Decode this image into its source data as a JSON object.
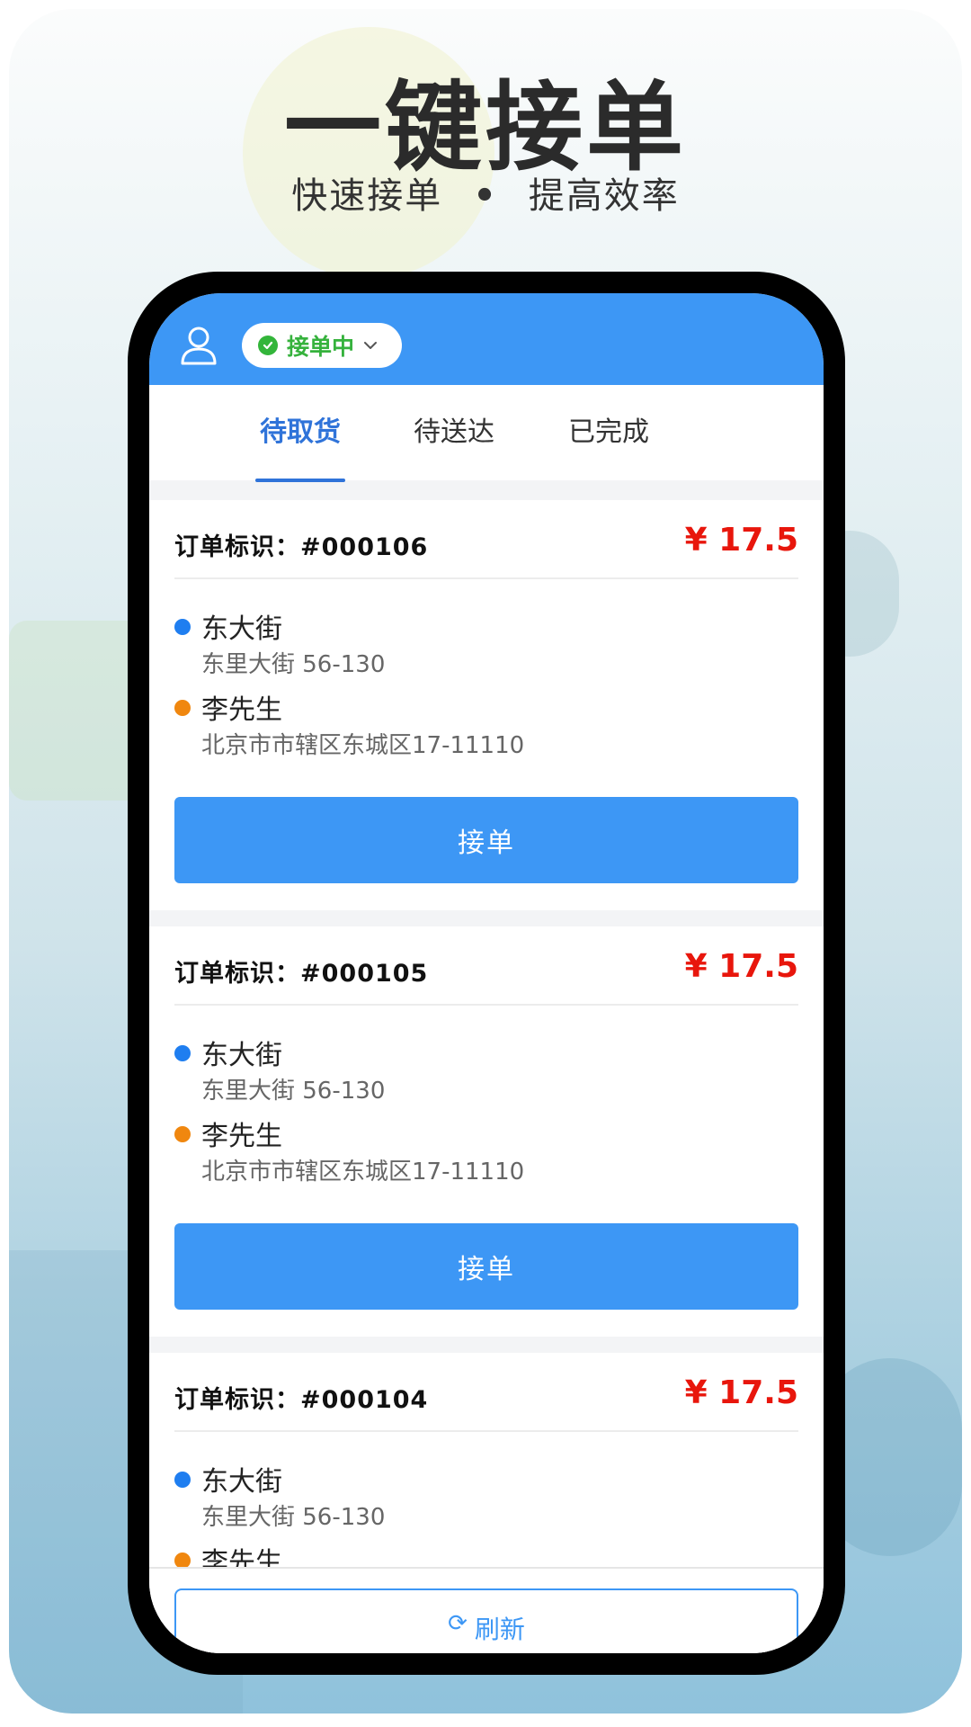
{
  "promo": {
    "headline": "一键接单",
    "subline_left": "快速接单",
    "subline_sep": "•",
    "subline_right": "提高效率"
  },
  "topbar": {
    "user_icon": "user-outline-icon",
    "status_label": "接单中",
    "status_icon": "check-circle-icon",
    "status_dropdown_icon": "chevron-down-icon"
  },
  "tabs": [
    {
      "label": "待取货",
      "active": true
    },
    {
      "label": "待送达",
      "active": false
    },
    {
      "label": "已完成",
      "active": false
    }
  ],
  "orders": [
    {
      "id_label": "订单标识：#000106",
      "price": "¥ 17.5",
      "pickup_name": "东大街",
      "pickup_address": "东里大街 56-130",
      "dropoff_name": "李先生",
      "dropoff_address": "北京市市辖区东城区17-11110",
      "button_label": "接单"
    },
    {
      "id_label": "订单标识：#000105",
      "price": "¥ 17.5",
      "pickup_name": "东大街",
      "pickup_address": "东里大街 56-130",
      "dropoff_name": "李先生",
      "dropoff_address": "北京市市辖区东城区17-11110",
      "button_label": "接单"
    },
    {
      "id_label": "订单标识：#000104",
      "price": "¥ 17.5",
      "pickup_name": "东大街",
      "pickup_address": "东里大街 56-130",
      "dropoff_name": "李先生"
    }
  ],
  "footer": {
    "refresh_label": "刷新",
    "refresh_icon": "refresh-icon"
  },
  "colors": {
    "accent_blue": "#3d97f5",
    "active_tab": "#2f73d9",
    "price_red": "#e8160c",
    "status_green": "#33b53a",
    "pickup_dot": "#1f7ef0",
    "dropoff_dot": "#f0870f"
  }
}
